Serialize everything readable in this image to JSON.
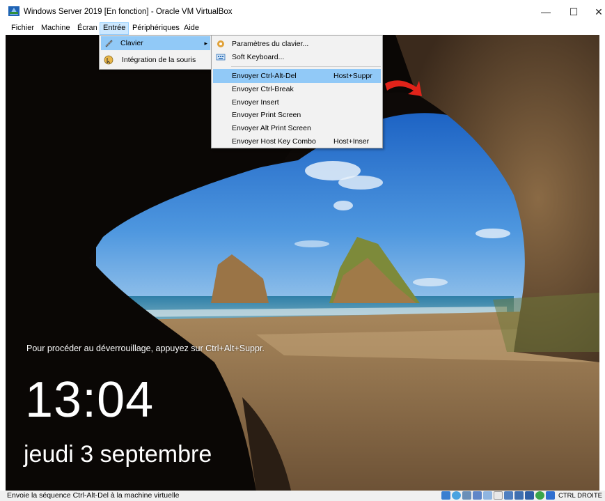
{
  "window": {
    "title": "Windows Server 2019 [En fonction] - Oracle VM VirtualBox",
    "minimize": "—",
    "maximize": "☐",
    "close": "✕"
  },
  "menubar": [
    "Fichier",
    "Machine",
    "Écran",
    "Entrée",
    "Périphériques",
    "Aide"
  ],
  "entree_menu": {
    "items": [
      "Clavier",
      "Intégration de la souris"
    ],
    "arrow": "▸"
  },
  "clavier_menu": {
    "items": [
      {
        "label": "Paramètres du clavier...",
        "shortcut": ""
      },
      {
        "label": "Soft Keyboard...",
        "shortcut": ""
      },
      {
        "label": "Envoyer Ctrl-Alt-Del",
        "shortcut": "Host+Suppr"
      },
      {
        "label": "Envoyer Ctrl-Break",
        "shortcut": ""
      },
      {
        "label": "Envoyer Insert",
        "shortcut": ""
      },
      {
        "label": "Envoyer Print Screen",
        "shortcut": ""
      },
      {
        "label": "Envoyer Alt Print Screen",
        "shortcut": ""
      },
      {
        "label": "Envoyer Host Key Combo",
        "shortcut": "Host+Inser"
      }
    ]
  },
  "lockscreen": {
    "message": "Pour procéder au déverrouillage, appuyez sur Ctrl+Alt+Suppr.",
    "time": "13:04",
    "date": "jeudi 3 septembre"
  },
  "statusbar": {
    "text": "Envoie la séquence Ctrl-Alt-Del à la machine virtuelle",
    "host_key": "CTRL DROITE"
  },
  "colors": {
    "highlight": "#91c9f7",
    "menu_active": "#cce8ff",
    "arrow": "#e0231a"
  }
}
